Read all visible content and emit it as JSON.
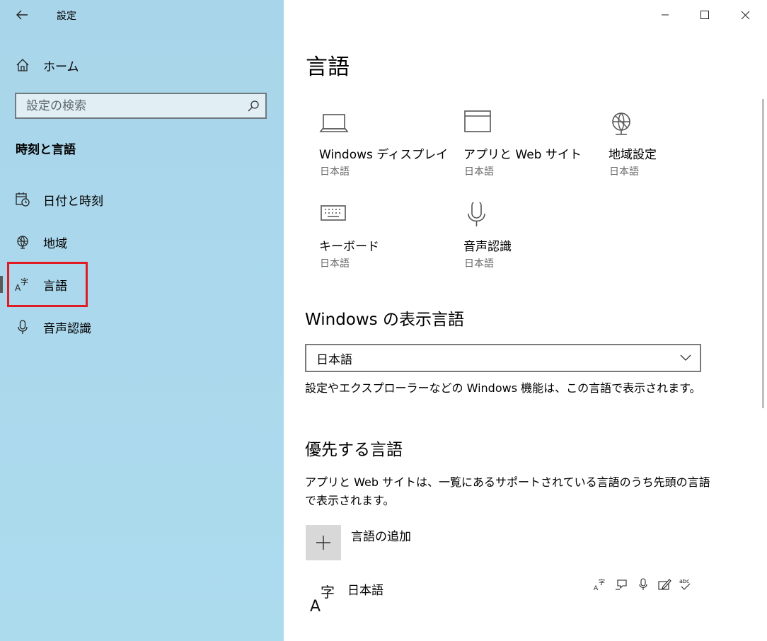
{
  "window": {
    "title": "設定",
    "controls": {
      "minimize": "minimize",
      "maximize": "maximize",
      "close": "close"
    }
  },
  "sidebar": {
    "home_label": "ホーム",
    "search_placeholder": "設定の検索",
    "section_title": "時刻と言語",
    "items": [
      {
        "label": "日付と時刻",
        "icon": "calendar-clock-icon"
      },
      {
        "label": "地域",
        "icon": "globe-icon"
      },
      {
        "label": "言語",
        "icon": "language-icon",
        "selected": true
      },
      {
        "label": "音声認識",
        "icon": "microphone-icon"
      }
    ]
  },
  "main": {
    "title": "言語",
    "tiles": [
      {
        "name": "Windows ディスプレイ",
        "sub": "日本語",
        "icon": "laptop-icon"
      },
      {
        "name": "アプリと Web サイト",
        "sub": "日本語",
        "icon": "browser-window-icon"
      },
      {
        "name": "地域設定",
        "sub": "日本語",
        "icon": "globe-icon"
      },
      {
        "name": "キーボード",
        "sub": "日本語",
        "icon": "keyboard-icon"
      },
      {
        "name": "音声認識",
        "sub": "日本語",
        "icon": "microphone-icon"
      }
    ],
    "display_language": {
      "heading": "Windows の表示言語",
      "selected": "日本語",
      "description": "設定やエクスプローラーなどの Windows 機能は、この言語で表示されます。"
    },
    "preferred": {
      "heading": "優先する言語",
      "description_line1": "アプリと Web サイトは、一覧にあるサポートされている言語のうち先頭の言語",
      "description_line2": "で表示されます。",
      "add_label": "言語の追加",
      "languages": [
        {
          "name": "日本語",
          "icon_glyph": "字",
          "features_label": "abc"
        }
      ]
    }
  },
  "colors": {
    "sidebar_bg": "#addbee",
    "highlight": "#e01b24",
    "add_button_bg": "#d8d8d8"
  }
}
